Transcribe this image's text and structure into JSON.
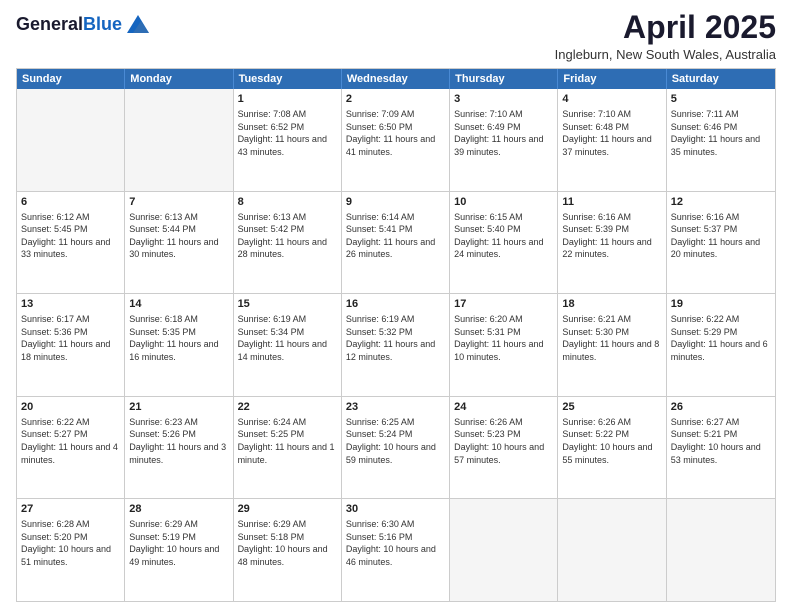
{
  "header": {
    "logo_general": "General",
    "logo_blue": "Blue",
    "month_title": "April 2025",
    "subtitle": "Ingleburn, New South Wales, Australia"
  },
  "days_of_week": [
    "Sunday",
    "Monday",
    "Tuesday",
    "Wednesday",
    "Thursday",
    "Friday",
    "Saturday"
  ],
  "weeks": [
    [
      {
        "day": "",
        "sunrise": "",
        "sunset": "",
        "daylight": "",
        "empty": true
      },
      {
        "day": "",
        "sunrise": "",
        "sunset": "",
        "daylight": "",
        "empty": true
      },
      {
        "day": "1",
        "sunrise": "Sunrise: 7:08 AM",
        "sunset": "Sunset: 6:52 PM",
        "daylight": "Daylight: 11 hours and 43 minutes.",
        "empty": false
      },
      {
        "day": "2",
        "sunrise": "Sunrise: 7:09 AM",
        "sunset": "Sunset: 6:50 PM",
        "daylight": "Daylight: 11 hours and 41 minutes.",
        "empty": false
      },
      {
        "day": "3",
        "sunrise": "Sunrise: 7:10 AM",
        "sunset": "Sunset: 6:49 PM",
        "daylight": "Daylight: 11 hours and 39 minutes.",
        "empty": false
      },
      {
        "day": "4",
        "sunrise": "Sunrise: 7:10 AM",
        "sunset": "Sunset: 6:48 PM",
        "daylight": "Daylight: 11 hours and 37 minutes.",
        "empty": false
      },
      {
        "day": "5",
        "sunrise": "Sunrise: 7:11 AM",
        "sunset": "Sunset: 6:46 PM",
        "daylight": "Daylight: 11 hours and 35 minutes.",
        "empty": false
      }
    ],
    [
      {
        "day": "6",
        "sunrise": "Sunrise: 6:12 AM",
        "sunset": "Sunset: 5:45 PM",
        "daylight": "Daylight: 11 hours and 33 minutes.",
        "empty": false
      },
      {
        "day": "7",
        "sunrise": "Sunrise: 6:13 AM",
        "sunset": "Sunset: 5:44 PM",
        "daylight": "Daylight: 11 hours and 30 minutes.",
        "empty": false
      },
      {
        "day": "8",
        "sunrise": "Sunrise: 6:13 AM",
        "sunset": "Sunset: 5:42 PM",
        "daylight": "Daylight: 11 hours and 28 minutes.",
        "empty": false
      },
      {
        "day": "9",
        "sunrise": "Sunrise: 6:14 AM",
        "sunset": "Sunset: 5:41 PM",
        "daylight": "Daylight: 11 hours and 26 minutes.",
        "empty": false
      },
      {
        "day": "10",
        "sunrise": "Sunrise: 6:15 AM",
        "sunset": "Sunset: 5:40 PM",
        "daylight": "Daylight: 11 hours and 24 minutes.",
        "empty": false
      },
      {
        "day": "11",
        "sunrise": "Sunrise: 6:16 AM",
        "sunset": "Sunset: 5:39 PM",
        "daylight": "Daylight: 11 hours and 22 minutes.",
        "empty": false
      },
      {
        "day": "12",
        "sunrise": "Sunrise: 6:16 AM",
        "sunset": "Sunset: 5:37 PM",
        "daylight": "Daylight: 11 hours and 20 minutes.",
        "empty": false
      }
    ],
    [
      {
        "day": "13",
        "sunrise": "Sunrise: 6:17 AM",
        "sunset": "Sunset: 5:36 PM",
        "daylight": "Daylight: 11 hours and 18 minutes.",
        "empty": false
      },
      {
        "day": "14",
        "sunrise": "Sunrise: 6:18 AM",
        "sunset": "Sunset: 5:35 PM",
        "daylight": "Daylight: 11 hours and 16 minutes.",
        "empty": false
      },
      {
        "day": "15",
        "sunrise": "Sunrise: 6:19 AM",
        "sunset": "Sunset: 5:34 PM",
        "daylight": "Daylight: 11 hours and 14 minutes.",
        "empty": false
      },
      {
        "day": "16",
        "sunrise": "Sunrise: 6:19 AM",
        "sunset": "Sunset: 5:32 PM",
        "daylight": "Daylight: 11 hours and 12 minutes.",
        "empty": false
      },
      {
        "day": "17",
        "sunrise": "Sunrise: 6:20 AM",
        "sunset": "Sunset: 5:31 PM",
        "daylight": "Daylight: 11 hours and 10 minutes.",
        "empty": false
      },
      {
        "day": "18",
        "sunrise": "Sunrise: 6:21 AM",
        "sunset": "Sunset: 5:30 PM",
        "daylight": "Daylight: 11 hours and 8 minutes.",
        "empty": false
      },
      {
        "day": "19",
        "sunrise": "Sunrise: 6:22 AM",
        "sunset": "Sunset: 5:29 PM",
        "daylight": "Daylight: 11 hours and 6 minutes.",
        "empty": false
      }
    ],
    [
      {
        "day": "20",
        "sunrise": "Sunrise: 6:22 AM",
        "sunset": "Sunset: 5:27 PM",
        "daylight": "Daylight: 11 hours and 4 minutes.",
        "empty": false
      },
      {
        "day": "21",
        "sunrise": "Sunrise: 6:23 AM",
        "sunset": "Sunset: 5:26 PM",
        "daylight": "Daylight: 11 hours and 3 minutes.",
        "empty": false
      },
      {
        "day": "22",
        "sunrise": "Sunrise: 6:24 AM",
        "sunset": "Sunset: 5:25 PM",
        "daylight": "Daylight: 11 hours and 1 minute.",
        "empty": false
      },
      {
        "day": "23",
        "sunrise": "Sunrise: 6:25 AM",
        "sunset": "Sunset: 5:24 PM",
        "daylight": "Daylight: 10 hours and 59 minutes.",
        "empty": false
      },
      {
        "day": "24",
        "sunrise": "Sunrise: 6:26 AM",
        "sunset": "Sunset: 5:23 PM",
        "daylight": "Daylight: 10 hours and 57 minutes.",
        "empty": false
      },
      {
        "day": "25",
        "sunrise": "Sunrise: 6:26 AM",
        "sunset": "Sunset: 5:22 PM",
        "daylight": "Daylight: 10 hours and 55 minutes.",
        "empty": false
      },
      {
        "day": "26",
        "sunrise": "Sunrise: 6:27 AM",
        "sunset": "Sunset: 5:21 PM",
        "daylight": "Daylight: 10 hours and 53 minutes.",
        "empty": false
      }
    ],
    [
      {
        "day": "27",
        "sunrise": "Sunrise: 6:28 AM",
        "sunset": "Sunset: 5:20 PM",
        "daylight": "Daylight: 10 hours and 51 minutes.",
        "empty": false
      },
      {
        "day": "28",
        "sunrise": "Sunrise: 6:29 AM",
        "sunset": "Sunset: 5:19 PM",
        "daylight": "Daylight: 10 hours and 49 minutes.",
        "empty": false
      },
      {
        "day": "29",
        "sunrise": "Sunrise: 6:29 AM",
        "sunset": "Sunset: 5:18 PM",
        "daylight": "Daylight: 10 hours and 48 minutes.",
        "empty": false
      },
      {
        "day": "30",
        "sunrise": "Sunrise: 6:30 AM",
        "sunset": "Sunset: 5:16 PM",
        "daylight": "Daylight: 10 hours and 46 minutes.",
        "empty": false
      },
      {
        "day": "",
        "sunrise": "",
        "sunset": "",
        "daylight": "",
        "empty": true
      },
      {
        "day": "",
        "sunrise": "",
        "sunset": "",
        "daylight": "",
        "empty": true
      },
      {
        "day": "",
        "sunrise": "",
        "sunset": "",
        "daylight": "",
        "empty": true
      }
    ]
  ]
}
